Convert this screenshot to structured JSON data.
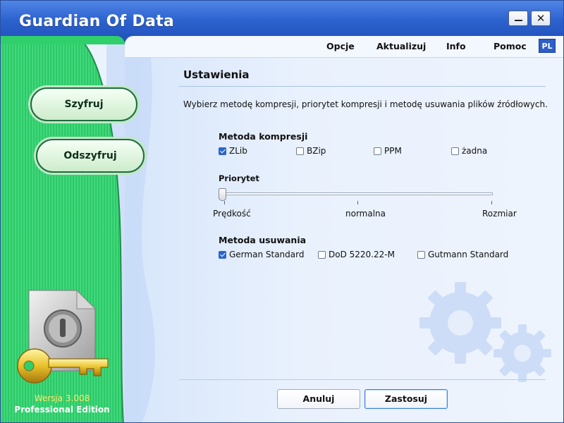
{
  "window": {
    "title": "Guardian Of Data",
    "controls": {
      "minimize": "minimize-icon",
      "close": "close-icon",
      "close_glyph": "✕"
    }
  },
  "menu": {
    "items": [
      "Opcje",
      "Aktualizuj",
      "Info",
      "Pomoc"
    ],
    "language": "PL"
  },
  "sidebar": {
    "encrypt_label": "Szyfruj",
    "decrypt_label": "Odszyfruj",
    "version": "Wersja 3.008",
    "edition": "Professional Edition",
    "logo_icon": "lock-and-key-icon",
    "colors": {
      "green": "#2bd06a",
      "dark_green": "#1e6b40",
      "version_text": "#ffe96a"
    }
  },
  "settings": {
    "title": "Ustawienia",
    "description": "Wybierz metodę kompresji, priorytet kompresji i metodę usuwania plików źródłowych.",
    "compression": {
      "label": "Metoda kompresji",
      "options": [
        {
          "label": "ZLib",
          "checked": true
        },
        {
          "label": "BZip",
          "checked": false
        },
        {
          "label": "PPM",
          "checked": false
        },
        {
          "label": "żadna",
          "checked": false
        }
      ]
    },
    "priority": {
      "label": "Priorytet",
      "min_label": "Prędkość",
      "mid_label": "normalna",
      "max_label": "Rozmiar",
      "value": 0
    },
    "deletion": {
      "label": "Metoda usuwania",
      "options": [
        {
          "label": "German Standard",
          "checked": true
        },
        {
          "label": "DoD 5220.22-M",
          "checked": false
        },
        {
          "label": "Gutmann Standard",
          "checked": false
        }
      ]
    }
  },
  "buttons": {
    "cancel": "Anuluj",
    "apply": "Zastosuj"
  },
  "decor": {
    "gear_icon": "gears-watermark-icon",
    "accent": "#2d63cf"
  }
}
